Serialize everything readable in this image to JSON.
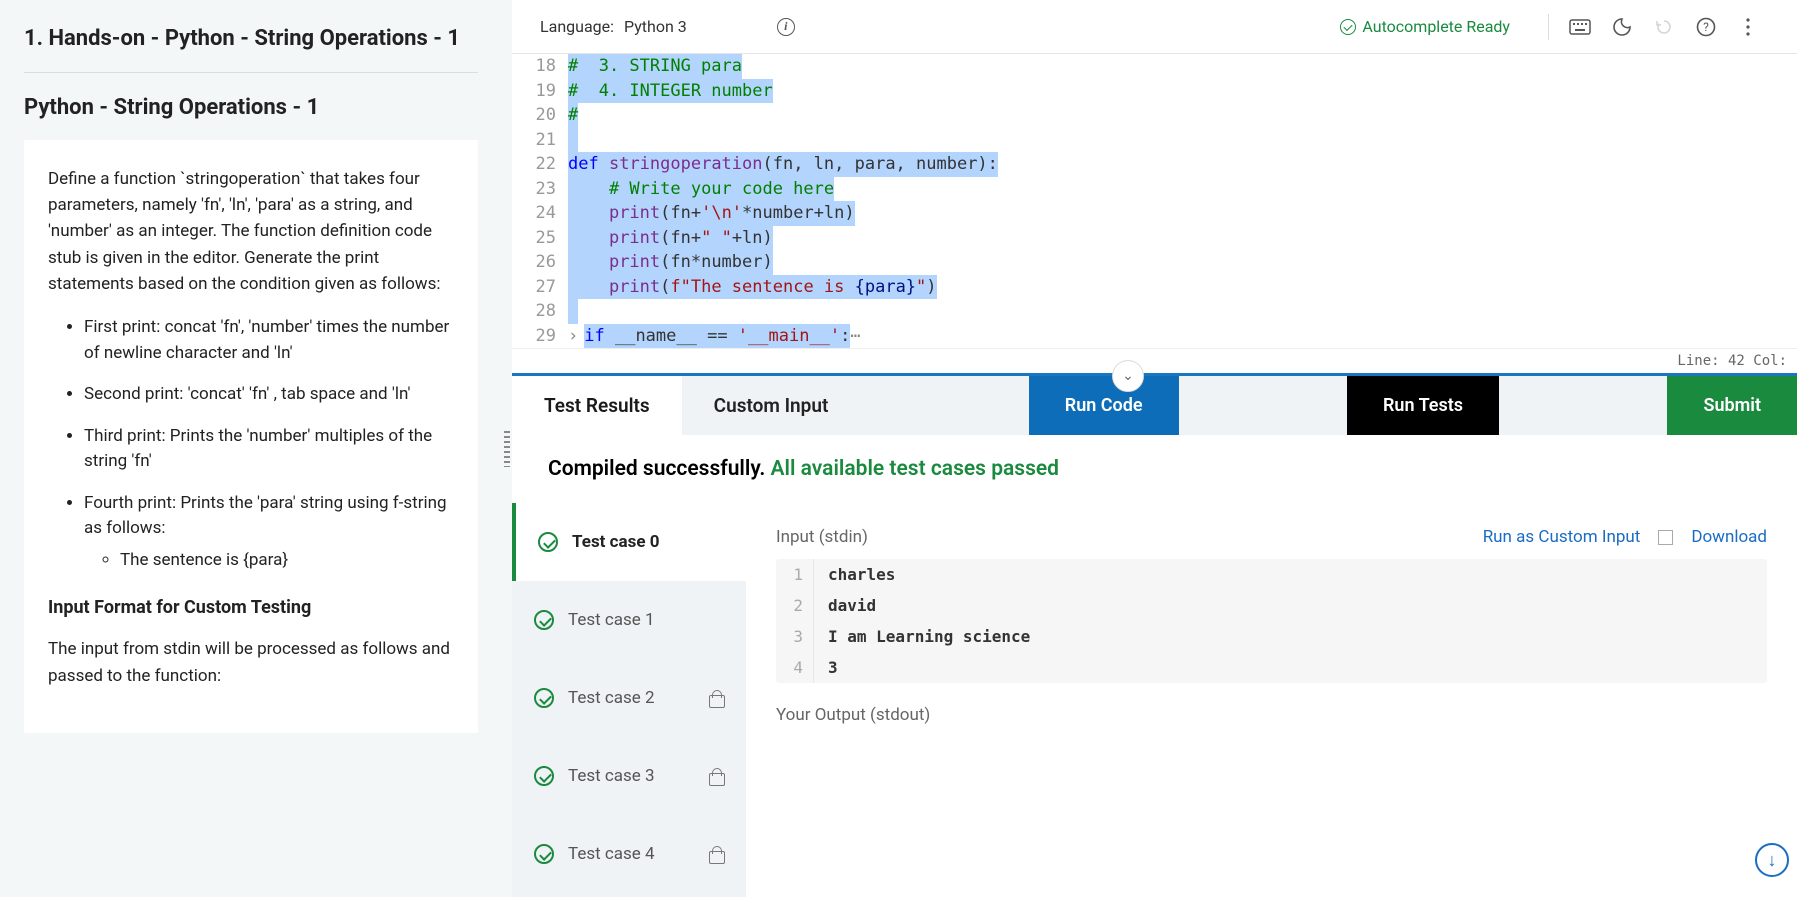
{
  "left": {
    "title": "1. Hands-on - Python - String Operations - 1",
    "subtitle": "Python - String Operations - 1",
    "intro": "Define a function `stringoperation` that takes four parameters, namely 'fn', 'ln', 'para' as a string, and 'number' as an integer. The function definition code stub is given in the editor. Generate the print statements based on the condition given as follows:",
    "bullets": [
      "First print: concat 'fn', 'number' times the number of newline character and 'ln'",
      "Second print: 'concat' 'fn' , tab space and 'ln'",
      "Third print: Prints the 'number' multiples of the string 'fn'",
      "Fourth print: Prints the 'para' string using f-string as follows:"
    ],
    "sub_bullet": "The sentence is {para}",
    "section_h": "Input Format for Custom Testing",
    "section_p": "The input from stdin will be processed as follows and passed to the function:"
  },
  "toolbar": {
    "lang_label": "Language:",
    "lang_value": "Python 3",
    "autocomplete": "Autocomplete Ready"
  },
  "editor": {
    "lines": [
      {
        "n": 18,
        "parts": [
          {
            "t": "#  3. STRING para",
            "c": "cm"
          }
        ]
      },
      {
        "n": 19,
        "parts": [
          {
            "t": "#  4. INTEGER number",
            "c": "cm"
          }
        ]
      },
      {
        "n": 20,
        "parts": [
          {
            "t": "#",
            "c": "cm"
          }
        ]
      },
      {
        "n": 21,
        "parts": [
          {
            "t": " ",
            "c": ""
          }
        ]
      },
      {
        "n": 22,
        "parts": [
          {
            "t": "def",
            "c": "kw"
          },
          {
            "t": " ",
            "c": ""
          },
          {
            "t": "stringoperation",
            "c": "fn"
          },
          {
            "t": "(fn, ln, para, number):",
            "c": ""
          }
        ]
      },
      {
        "n": 23,
        "parts": [
          {
            "t": "    ",
            "c": ""
          },
          {
            "t": "# Write your code here",
            "c": "cm"
          }
        ]
      },
      {
        "n": 24,
        "parts": [
          {
            "t": "    ",
            "c": ""
          },
          {
            "t": "print",
            "c": "fn"
          },
          {
            "t": "(fn+",
            "c": ""
          },
          {
            "t": "'\\n'",
            "c": "str"
          },
          {
            "t": "*number+ln)",
            "c": ""
          }
        ]
      },
      {
        "n": 25,
        "parts": [
          {
            "t": "    ",
            "c": ""
          },
          {
            "t": "print",
            "c": "fn"
          },
          {
            "t": "(fn+",
            "c": ""
          },
          {
            "t": "\" \"",
            "c": "str"
          },
          {
            "t": "+ln)",
            "c": ""
          }
        ]
      },
      {
        "n": 26,
        "parts": [
          {
            "t": "    ",
            "c": ""
          },
          {
            "t": "print",
            "c": "fn"
          },
          {
            "t": "(fn*number)",
            "c": ""
          }
        ]
      },
      {
        "n": 27,
        "parts": [
          {
            "t": "    ",
            "c": ""
          },
          {
            "t": "print",
            "c": "fn"
          },
          {
            "t": "(",
            "c": ""
          },
          {
            "t": "f\"The sentence is ",
            "c": "str"
          },
          {
            "t": "{para}",
            "c": "var"
          },
          {
            "t": "\"",
            "c": "str"
          },
          {
            "t": ")",
            "c": ""
          }
        ]
      },
      {
        "n": 28,
        "parts": [
          {
            "t": " ",
            "c": ""
          }
        ]
      },
      {
        "n": 29,
        "parts": [
          {
            "t": "if",
            "c": "kw"
          },
          {
            "t": " __name__ == ",
            "c": ""
          },
          {
            "t": "'__main__'",
            "c": "str"
          },
          {
            "t": ":",
            "c": ""
          }
        ],
        "fold": true
      }
    ],
    "status": "Line: 42 Col:"
  },
  "tabs": {
    "results": "Test Results",
    "custom": "Custom Input",
    "run_code": "Run Code",
    "run_tests": "Run Tests",
    "submit": "Submit"
  },
  "result_msg": {
    "prefix": "Compiled successfully. ",
    "ok": "All available test cases passed"
  },
  "testcases": [
    {
      "label": "Test case 0",
      "active": true,
      "locked": false
    },
    {
      "label": "Test case 1",
      "active": false,
      "locked": false
    },
    {
      "label": "Test case 2",
      "active": false,
      "locked": true
    },
    {
      "label": "Test case 3",
      "active": false,
      "locked": true
    },
    {
      "label": "Test case 4",
      "active": false,
      "locked": true
    }
  ],
  "output": {
    "input_h": "Input (stdin)",
    "link_custom": "Run as Custom Input",
    "link_download": "Download",
    "input_lines": [
      "charles",
      "david",
      "I am Learning science",
      "3"
    ],
    "stdout_h": "Your Output (stdout)"
  },
  "chart_data": null
}
